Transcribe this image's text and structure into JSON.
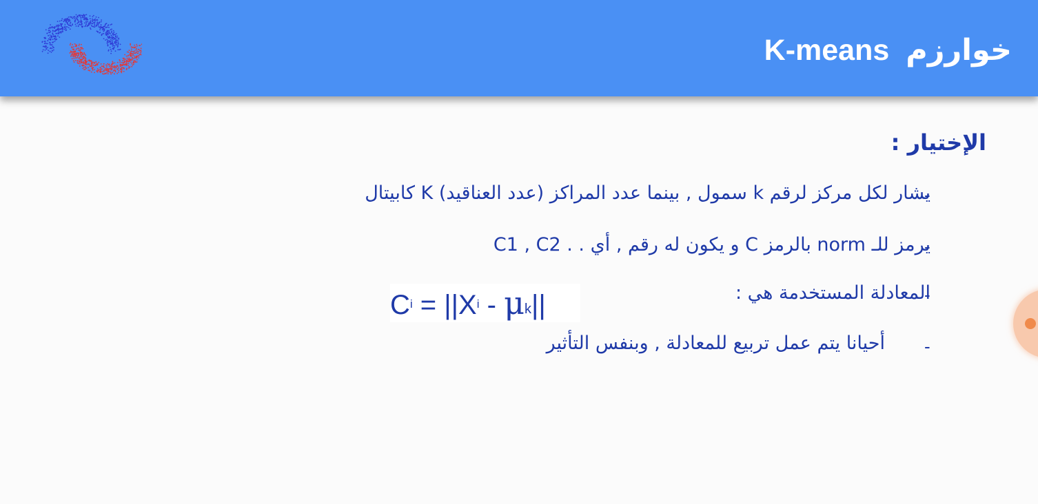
{
  "header": {
    "title_arabic": "خوارزم",
    "title_latin": "K-means",
    "background_color": "#4a90f4",
    "logo_icon": "clustering-logo-icon"
  },
  "section": {
    "title": "الإختيار :"
  },
  "bullets": [
    {
      "dash": "-",
      "text": "يشار لكل مركز لرقم k سمول , بينما عدد المراكز (عدد العناقيد) K كابيتال"
    },
    {
      "dash": "-",
      "text": "يرمز للـ norm بالرمز C و يكون له رقم , أي . . C1 , C2"
    },
    {
      "dash": "-",
      "text": "المعادلة المستخدمة هي :"
    },
    {
      "dash": "-",
      "text": "أحيانا يتم عمل تربيع للمعادلة , وبنفس التأثير"
    }
  ],
  "formula": {
    "c": "C",
    "c_sup": "i",
    "equals_bars": " = ||",
    "x": "X",
    "x_sup": "i",
    "minus": " - ",
    "mu": "μ",
    "mu_sub": "k",
    "end_bars": "||"
  },
  "text_color": "#1f3aa8",
  "pointer_color": "#f08a4b"
}
